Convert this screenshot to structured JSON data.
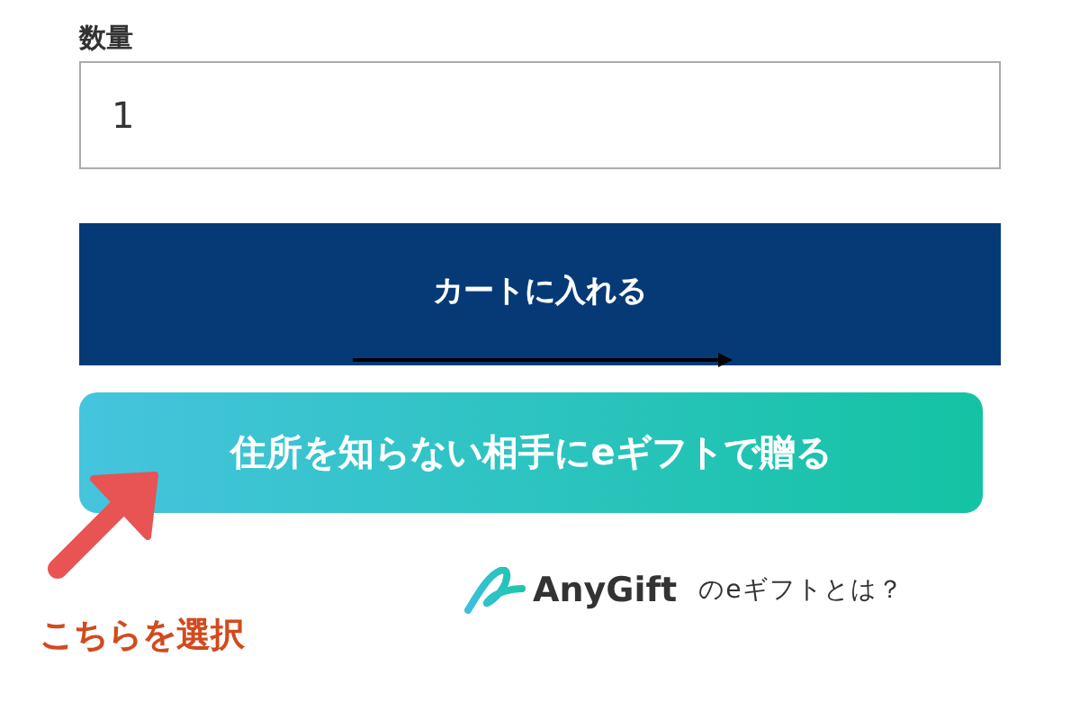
{
  "quantity": {
    "label": "数量",
    "value": "1"
  },
  "cart_button": {
    "label": "カートに入れる"
  },
  "gift_button": {
    "label": "住所を知らない相手にeギフトで贈る"
  },
  "anygift_info": {
    "brand": "AnyGift",
    "link": "のeギフトとは？"
  },
  "annotation": {
    "text": "こちらを選択"
  }
}
